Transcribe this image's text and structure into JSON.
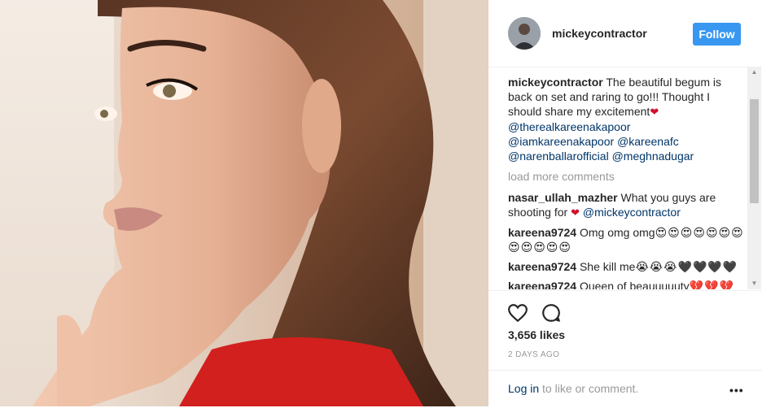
{
  "header": {
    "username": "mickeycontractor",
    "follow_label": "Follow"
  },
  "caption": {
    "username": "mickeycontractor",
    "text": " The beautiful begum is back on set and raring to go!!! Thought I should share my excitement",
    "heart": "❤",
    "mentions": [
      "@therealkareenakapoor",
      "@iamkareenakapoor",
      "@kareenafc",
      "@narenballarofficial",
      "@meghnadugar"
    ]
  },
  "load_more_label": "load more comments",
  "comments": [
    {
      "username": "nasar_ullah_mazher",
      "text": " What you guys are shooting for ",
      "heart": "❤",
      "mention": " @mickeycontractor"
    },
    {
      "username": "kareena9724",
      "text": " Omg omg omg",
      "emoji": "😍😍😍😍😍😍😍😍😍😍😍😍"
    },
    {
      "username": "kareena9724",
      "text": " She kill me",
      "emoji": "😭😭😭🖤🖤🖤🖤"
    },
    {
      "username": "kareena9724",
      "text": " Queen of beauuuuuty",
      "emoji": "💔💔💔"
    }
  ],
  "likes": "3,656 likes",
  "time_ago": "2 DAYS AGO",
  "footer": {
    "login_label": "Log in",
    "suffix": " to like or comment.",
    "more_label": "•••"
  },
  "icons": {
    "like": "heart-outline-icon",
    "comment": "speech-bubble-icon",
    "more": "ellipsis-icon"
  },
  "colors": {
    "follow_button": "#3897f0",
    "mention_link": "#003569",
    "muted_text": "#999999",
    "heart_red": "#d0102a"
  }
}
